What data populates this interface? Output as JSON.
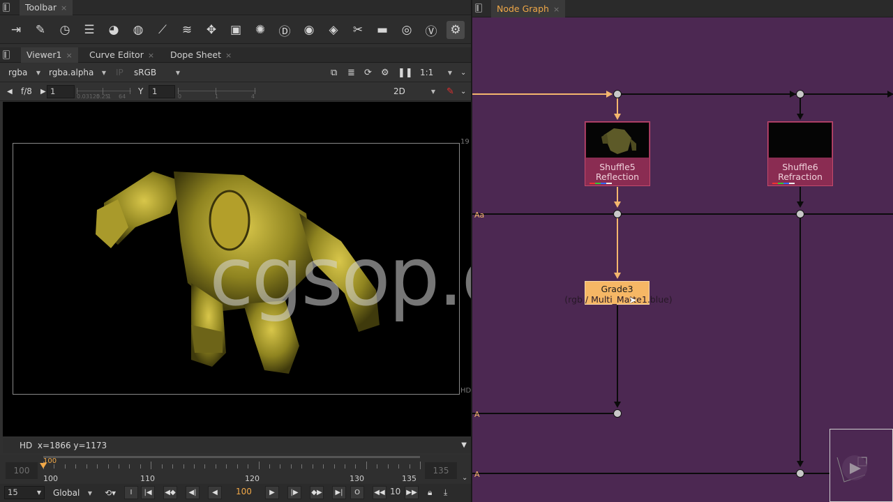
{
  "left_tabs": {
    "toolbar_tab": "Toolbar",
    "close_glyph": "×"
  },
  "toolbar_tools": [
    "import-icon",
    "paint-brush-icon",
    "time-icon",
    "channel-icon",
    "color-icon",
    "filter-icon",
    "keyer-icon",
    "merge-icon",
    "transform-icon",
    "3d-icon",
    "particles-icon",
    "deep-icon",
    "views-icon",
    "metadata-icon",
    "toolsets-icon",
    "other-icon",
    "furnace-icon",
    "vray-icon",
    "plugins-icon"
  ],
  "viewer_tabs": [
    {
      "label": "Viewer1",
      "active": true
    },
    {
      "label": "Curve Editor",
      "active": false
    },
    {
      "label": "Dope Sheet",
      "active": false
    }
  ],
  "viewer_controls": {
    "channels": "rgba",
    "alpha_channel": "rgba.alpha",
    "ip_label": "IP",
    "lut": "sRGB",
    "zoom": "1:1",
    "fstop": "f/8",
    "gain_value": "1",
    "gamma_label": "Y",
    "gamma_value": "1",
    "gain_ticks": [
      "0.03125",
      "0.25",
      "1",
      "64"
    ],
    "gamma_ticks": [
      "0",
      "1",
      "4"
    ],
    "view_mode": "2D"
  },
  "viewer": {
    "frame_top_num": "19",
    "format_label": "HD",
    "watermark": "cgsop.com"
  },
  "status": {
    "format": "HD",
    "coords": "x=1866 y=1173"
  },
  "timeline": {
    "start_box": "100",
    "end_box": "135",
    "cursor_frame": "100",
    "labels": [
      "100",
      "110",
      "120",
      "130",
      "135"
    ],
    "current_fraction": 0.0
  },
  "playbar": {
    "fps": "15",
    "scope": "Global",
    "in_btn": "I",
    "out_btn": "O",
    "current_frame": "100",
    "step": "10"
  },
  "node_graph": {
    "tab_label": "Node Graph",
    "close_glyph": "×",
    "nodes": [
      {
        "name": "Shuffle5",
        "label": "Reflection"
      },
      {
        "name": "Shuffle6",
        "label": "Refraction"
      },
      {
        "name": "Grade3",
        "label": "(rgb / Multi_Matte1.blue)"
      }
    ],
    "input_labels": [
      "Aa",
      "A",
      "A"
    ],
    "colors": {
      "background": "#4c2852",
      "selected_pipe": "#f4b66e",
      "node": "#8a2c52",
      "grade": "#f6b765"
    }
  }
}
